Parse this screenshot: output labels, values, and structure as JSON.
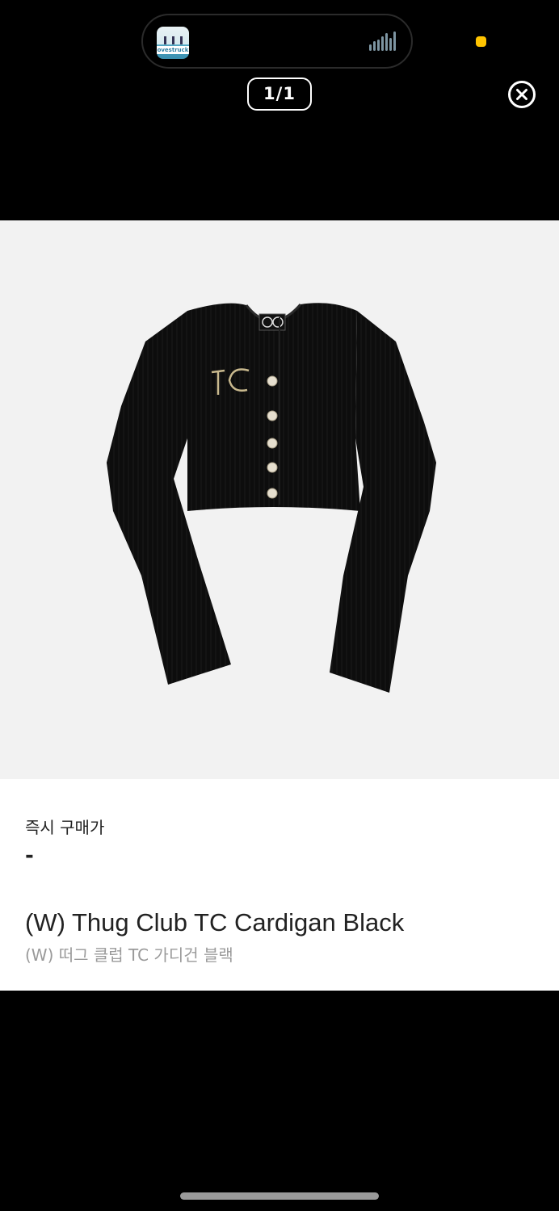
{
  "now_playing": {
    "album_caption": "ovestruck",
    "waveform_icon": "waveform-icon"
  },
  "colors": {
    "indicator_dot": "#ffc400",
    "background": "#000000",
    "image_background": "#f2f2f2",
    "price_text": "#222222",
    "subtitle_text": "#9a9a9a"
  },
  "viewer": {
    "page_counter": "1/1",
    "close_icon": "close-circle-icon"
  },
  "product": {
    "image_subject": "black cropped ribbed cardigan",
    "price_label": "즉시 구매가",
    "price_value": "-",
    "name_en": "(W) Thug Club TC Cardigan Black",
    "name_ko": "(W) 떠그 클럽 TC 가디건 블랙"
  }
}
